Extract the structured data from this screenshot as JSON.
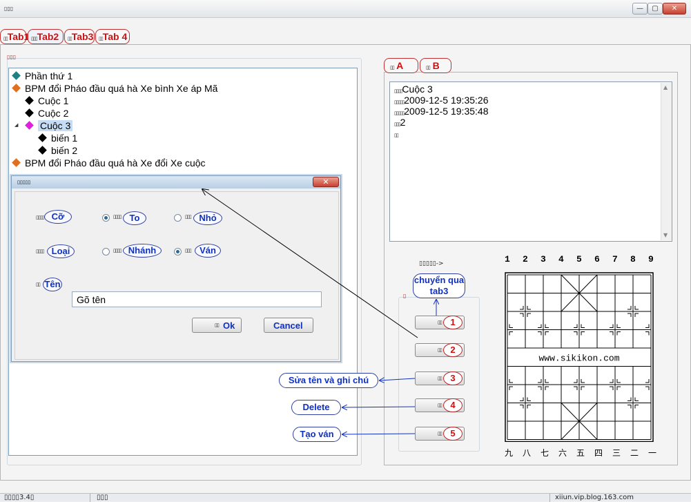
{
  "window": {
    "title": "▯▯▯",
    "min_label": "—",
    "max_label": "▢",
    "close_label": "✕"
  },
  "top_tabs": [
    {
      "label": "Tab1",
      "prefix": "▯▯"
    },
    {
      "label": "Tab2",
      "prefix": "▯▯▯"
    },
    {
      "label": "Tab3",
      "prefix": "▯▯"
    },
    {
      "label": "Tab 4",
      "prefix": "▯▯"
    }
  ],
  "left_group_label": "▯▯▯",
  "tree": {
    "nodes": [
      {
        "text": "Phần thứ 1",
        "color": "#208080",
        "level": 0
      },
      {
        "text": "BPM đổi Pháo đầu quá hà Xe bình Xe áp Mã",
        "color": "#e07020",
        "level": 0
      },
      {
        "text": "Cuộc 1",
        "color": "#000000",
        "level": 1
      },
      {
        "text": "Cuộc 2",
        "color": "#000000",
        "level": 1
      },
      {
        "text": "Cuộc 3",
        "color": "#e020e0",
        "level": 1,
        "selected": true,
        "expand_glyph": "◢"
      },
      {
        "text": "biến 1",
        "color": "#000000",
        "level": 2
      },
      {
        "text": "biến 2",
        "color": "#000000",
        "level": 2
      },
      {
        "text": "BPM đổi Pháo đầu quá hà Xe đổi Xe cuộc",
        "color": "#e07020",
        "level": 0
      }
    ]
  },
  "dialog": {
    "title": "▯▯▯▯▯",
    "close_label": "✕",
    "size": {
      "prefix": "▯▯▯▯",
      "label": "Cỡ",
      "opt1_prefix": "▯▯▯▯",
      "opt1": "To",
      "opt2_prefix": "▯▯▯",
      "opt2": "Nhỏ"
    },
    "type": {
      "prefix": "▯▯▯▯",
      "label": "Loại",
      "opt1_prefix": "▯▯▯▯",
      "opt1": "Nhánh",
      "opt2_prefix": "▯▯▯",
      "opt2": "Ván"
    },
    "name": {
      "prefix": "▯▯",
      "label": "Tên",
      "value": "Gõ tên"
    },
    "ok_prefix": "▯▯",
    "ok_label": "Ok",
    "cancel_label": "Cancel"
  },
  "right_tabs": [
    {
      "prefix": "▯▯",
      "label": "A"
    },
    {
      "prefix": "▯▯",
      "label": "B"
    }
  ],
  "info_lines": [
    {
      "prefix": "▯▯▯▯",
      "text": "Cuộc 3"
    },
    {
      "prefix": "▯▯▯▯▯",
      "text": "2009-12-5 19:35:26"
    },
    {
      "prefix": "▯▯▯▯▯",
      "text": "2009-12-5 19:35:48"
    },
    {
      "prefix": "▯▯▯",
      "text": "2"
    },
    {
      "prefix": "▯▯",
      "text": ""
    }
  ],
  "arrow_note": "▯▯▯▯▯->",
  "btn_group_label": "▯",
  "side_buttons": [
    {
      "num": "1",
      "label": "▯▯"
    },
    {
      "num": "2",
      "label": "▯▯"
    },
    {
      "num": "3",
      "label": "▯▯"
    },
    {
      "num": "4",
      "label": "▯▯"
    },
    {
      "num": "5",
      "label": "▯▯"
    }
  ],
  "callouts": {
    "tab3": "chuyển qua tab3",
    "rename": "Sửa tên và ghi chú",
    "delete": "Delete",
    "create": "Tạo ván"
  },
  "board": {
    "top_files": [
      "1",
      "2",
      "3",
      "4",
      "5",
      "6",
      "7",
      "8",
      "9"
    ],
    "bottom_files": [
      "九",
      "八",
      "七",
      "六",
      "五",
      "四",
      "三",
      "二",
      "一"
    ],
    "river_text": "www.sikikon.com"
  },
  "status": {
    "left": "▯▯▯▯3.4▯",
    "mid": "▯▯▯",
    "right": "xiiun.vip.blog.163.com"
  }
}
